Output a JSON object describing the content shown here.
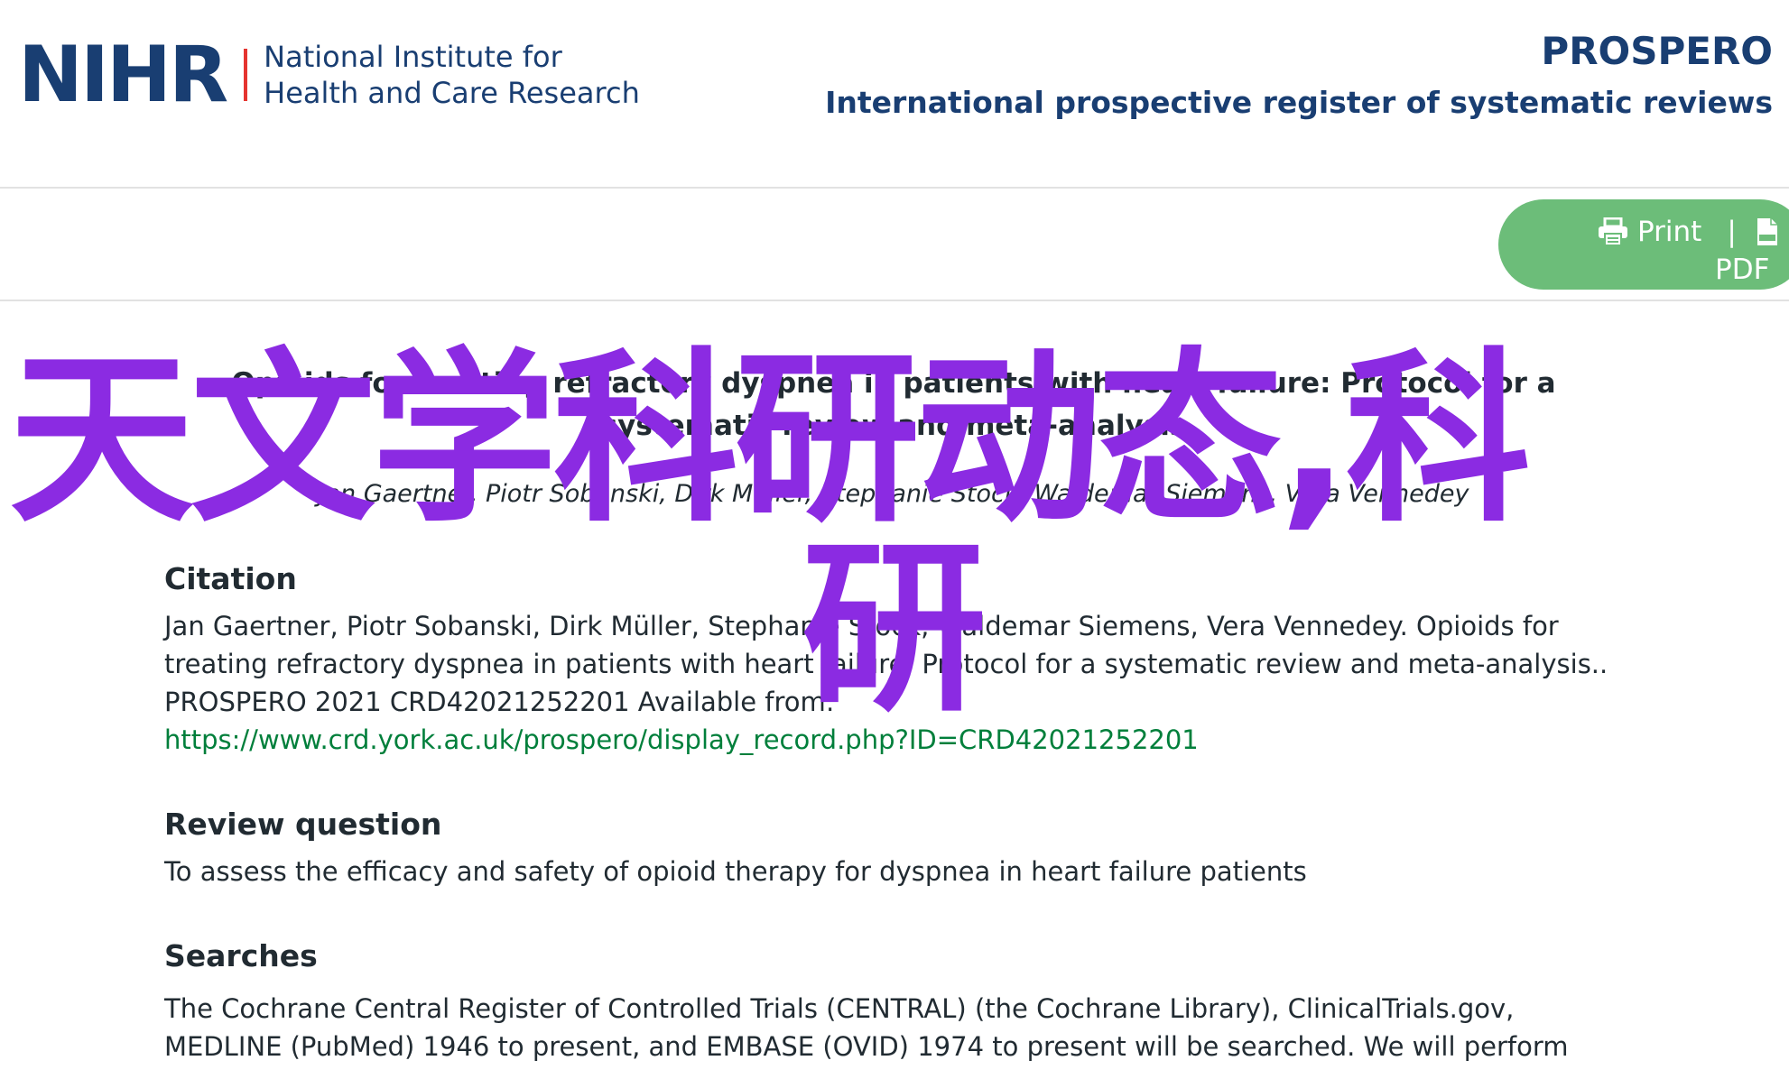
{
  "header": {
    "nihr_mark": "NIHR",
    "nihr_name_line1": "National Institute for",
    "nihr_name_line2": "Health and Care Research",
    "prospero_title": "PROSPERO",
    "prospero_subtitle": "International prospective register of systematic reviews"
  },
  "toolbar": {
    "print_label": "Print",
    "separator": "|",
    "pdf_label": "PDF",
    "pill_color": "#6cbd79"
  },
  "record": {
    "title": "Opioids for treating refractory dyspnea in patients with heart failure: Protocol for a systematic review and meta-analysis",
    "authors": "Jan Gaertner, Piotr Sobanski, Dirk Müller, Stephanie Stock, Waldemar Siemens, Vera Vennedey"
  },
  "citation": {
    "heading": "Citation",
    "text": "Jan Gaertner, Piotr Sobanski, Dirk Müller, Stephanie Stock, Waldemar Siemens, Vera Vennedey. Opioids for treating refractory dyspnea in patients with heart failure: Protocol for a systematic review and meta-analysis.. PROSPERO 2021 CRD42021252201 Available from:",
    "link": "https://www.crd.york.ac.uk/prospero/display_record.php?ID=CRD42021252201",
    "link_color": "#007f3b"
  },
  "review_question": {
    "heading": "Review question",
    "text": "To assess the efficacy and safety of opioid therapy for dyspnea in heart failure patients"
  },
  "searches": {
    "heading": "Searches",
    "text": "The Cochrane Central Register of Controlled Trials (CENTRAL) (the Cochrane Library), ClinicalTrials.gov, MEDLINE (PubMed) 1946 to present, and EMBASE (OVID) 1974 to present will be searched. We will perform"
  },
  "watermark": {
    "line1": "天文学科研动态,科",
    "line2": "研",
    "color": "#8b2be2"
  }
}
